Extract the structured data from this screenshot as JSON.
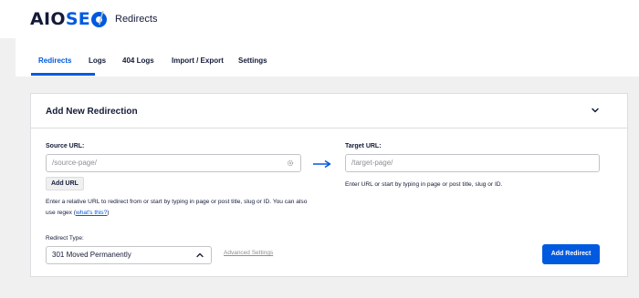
{
  "header": {
    "logo_aio": "AIO",
    "logo_seo": "SE",
    "separator": "/",
    "breadcrumb": "Redirects"
  },
  "tabs": [
    {
      "label": "Redirects",
      "active": true
    },
    {
      "label": "Logs",
      "active": false
    },
    {
      "label": "404 Logs",
      "active": false
    },
    {
      "label": "Import / Export",
      "active": false
    },
    {
      "label": "Settings",
      "active": false
    }
  ],
  "card": {
    "title": "Add New Redirection",
    "source": {
      "label": "Source URL:",
      "placeholder": "/source-page/",
      "add_url_label": "Add URL",
      "help_text": "Enter a relative URL to redirect from or start by typing in page or post title, slug or ID. You can also use regex (",
      "help_link": "what's this?",
      "help_close": ")"
    },
    "target": {
      "label": "Target URL:",
      "placeholder": "/target-page/",
      "help_text": "Enter URL or start by typing in page or post title, slug or ID."
    },
    "redirect_type": {
      "label": "Redirect Type:",
      "selected": "301 Moved Permanently"
    },
    "advanced_settings_label": "Advanced Settings",
    "submit_label": "Add Redirect"
  },
  "colors": {
    "accent": "#005ae0",
    "text": "#141b38",
    "background": "#f0f0f1"
  },
  "icons": {
    "source_field": "gear-icon",
    "arrow": "arrow-right-icon",
    "collapse": "chevron-down-icon",
    "select": "chevron-up-icon"
  }
}
